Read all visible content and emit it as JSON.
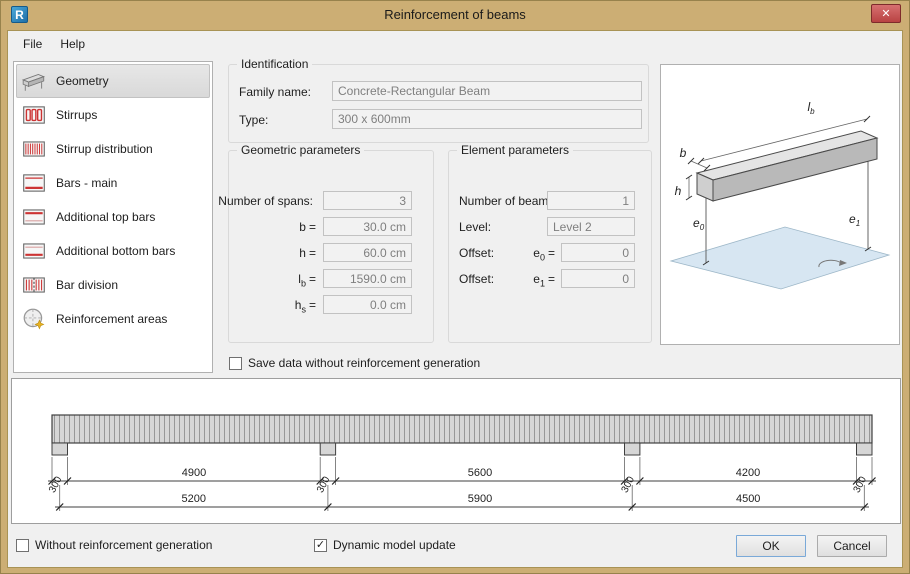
{
  "window": {
    "title": "Reinforcement of beams"
  },
  "glyphs": {
    "app_letter": "R",
    "close": "✕",
    "check": "✓"
  },
  "menu": {
    "file": "File",
    "help": "Help"
  },
  "sidebar": {
    "items": [
      {
        "label": "Geometry",
        "selected": true
      },
      {
        "label": "Stirrups"
      },
      {
        "label": "Stirrup distribution"
      },
      {
        "label": "Bars - main"
      },
      {
        "label": "Additional top bars"
      },
      {
        "label": "Additional bottom bars"
      },
      {
        "label": "Bar division"
      },
      {
        "label": "Reinforcement areas"
      }
    ]
  },
  "identification": {
    "title": "Identification",
    "family_label": "Family name:",
    "family_value": "Concrete-Rectangular Beam",
    "type_label": "Type:",
    "type_value": "300 x 600mm"
  },
  "geometric": {
    "title": "Geometric parameters",
    "rows": [
      {
        "label": "Number of spans:",
        "var": "",
        "sub": "",
        "eq": "",
        "value": "3"
      },
      {
        "label": "",
        "var": "b",
        "sub": "",
        "eq": "=",
        "value": "30.0 cm"
      },
      {
        "label": "",
        "var": "h",
        "sub": "",
        "eq": "=",
        "value": "60.0 cm"
      },
      {
        "label": "",
        "var": "l",
        "sub": "b",
        "eq": "=",
        "value": "1590.0 cm"
      },
      {
        "label": "",
        "var": "h",
        "sub": "s",
        "eq": "=",
        "value": "0.0 cm"
      }
    ]
  },
  "element": {
    "title": "Element parameters",
    "rows": [
      {
        "label": "Number of beams:",
        "var": "",
        "sub": "",
        "eq": "",
        "value": "1"
      },
      {
        "label": "Level:",
        "var": "",
        "sub": "",
        "eq": "",
        "value": "Level 2"
      },
      {
        "label": "Offset:",
        "var": "e",
        "sub": "0",
        "eq": "=",
        "value": "0"
      },
      {
        "label": "Offset:",
        "var": "e",
        "sub": "1",
        "eq": "=",
        "value": "0"
      }
    ]
  },
  "save_checkbox": {
    "label": "Save data without reinforcement generation",
    "checked": false
  },
  "preview": {
    "labels": {
      "b": "b",
      "l_main": "l",
      "l_sub": "b",
      "h": "h",
      "e_main": "e",
      "e0_sub": "0",
      "e1_sub": "1"
    }
  },
  "drawing": {
    "support_width": "300",
    "spans": [
      "4900",
      "5600",
      "4200"
    ],
    "totals": [
      "5200",
      "5900",
      "4500"
    ]
  },
  "footer": {
    "without_label": "Without reinforcement generation",
    "without_checked": false,
    "dynamic_label": "Dynamic model update",
    "dynamic_checked": true,
    "ok": "OK",
    "cancel": "Cancel"
  }
}
